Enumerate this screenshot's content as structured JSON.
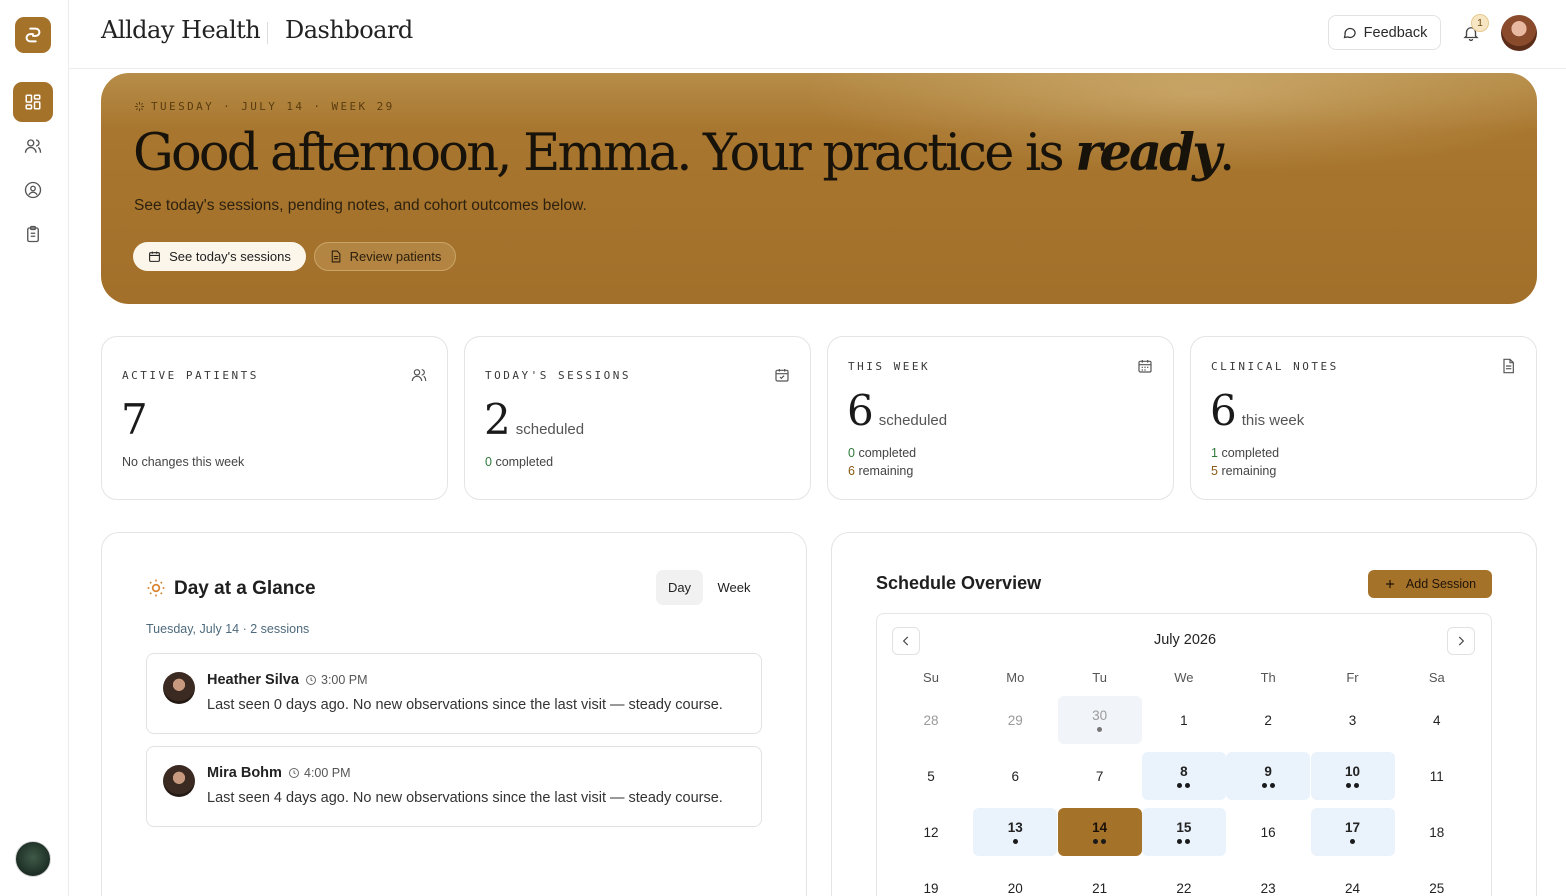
{
  "header": {
    "brand": "Allday Health",
    "page_title": "Dashboard",
    "feedback_label": "Feedback",
    "notification_count": "1"
  },
  "sidebar": {
    "items": [
      {
        "name": "dashboard",
        "icon": "grid-icon",
        "active": true
      },
      {
        "name": "patients",
        "icon": "users-icon",
        "active": false
      },
      {
        "name": "profile",
        "icon": "user-circle-icon",
        "active": false
      },
      {
        "name": "notes",
        "icon": "clipboard-icon",
        "active": false
      }
    ]
  },
  "hero": {
    "date_line": "TUESDAY · JULY 14 · WEEK 29",
    "greeting": "Good afternoon, Emma. Your practice is ",
    "greeting_emphasis": "ready",
    "greeting_end": ".",
    "subtitle": "See today's sessions, pending notes, and cohort outcomes below.",
    "btn_sessions": "See today's sessions",
    "btn_review": "Review patients"
  },
  "stats": {
    "active_patients": {
      "label": "ACTIVE PATIENTS",
      "value": "7",
      "note": "No changes this week"
    },
    "todays_sessions": {
      "label": "TODAY'S SESSIONS",
      "value": "2",
      "unit": "scheduled",
      "completed_num": "0",
      "completed_label": "completed"
    },
    "this_week": {
      "label": "THIS WEEK",
      "value": "6",
      "unit": "scheduled",
      "completed_num": "0",
      "completed_label": "completed",
      "remaining_num": "6",
      "remaining_label": "remaining"
    },
    "clinical_notes": {
      "label": "CLINICAL NOTES",
      "value": "6",
      "unit": "this week",
      "completed_num": "1",
      "completed_label": "completed",
      "remaining_num": "5",
      "remaining_label": "remaining"
    }
  },
  "day_glance": {
    "title": "Day at a Glance",
    "tab_day": "Day",
    "tab_week": "Week",
    "date_line": "Tuesday, July 14 · 2 sessions",
    "sessions": [
      {
        "name": "Heather Silva",
        "time": "3:00 PM",
        "text": "Last seen 0 days ago. No new observations since the last visit — steady course."
      },
      {
        "name": "Mira Bohm",
        "time": "4:00 PM",
        "text": "Last seen 4 days ago. No new observations since the last visit — steady course."
      }
    ]
  },
  "schedule": {
    "title": "Schedule Overview",
    "add_label": "Add Session",
    "month": "July 2026",
    "weekdays": [
      "Su",
      "Mo",
      "Tu",
      "We",
      "Th",
      "Fr",
      "Sa"
    ],
    "weeks": [
      [
        {
          "d": "28",
          "muted": true,
          "dots": 0
        },
        {
          "d": "29",
          "muted": true,
          "dots": 0
        },
        {
          "d": "30",
          "muted": true,
          "dots": 1,
          "prev": true
        },
        {
          "d": "1",
          "dots": 0
        },
        {
          "d": "2",
          "dots": 0
        },
        {
          "d": "3",
          "dots": 0
        },
        {
          "d": "4",
          "dots": 0
        }
      ],
      [
        {
          "d": "5",
          "dots": 0
        },
        {
          "d": "6",
          "dots": 0
        },
        {
          "d": "7",
          "dots": 0
        },
        {
          "d": "8",
          "dots": 2,
          "hl": true
        },
        {
          "d": "9",
          "dots": 2,
          "hl": true
        },
        {
          "d": "10",
          "dots": 2,
          "hl": true
        },
        {
          "d": "11",
          "dots": 0
        }
      ],
      [
        {
          "d": "12",
          "dots": 0
        },
        {
          "d": "13",
          "dots": 1,
          "hl": true
        },
        {
          "d": "14",
          "dots": 2,
          "sel": true
        },
        {
          "d": "15",
          "dots": 2,
          "hl": true
        },
        {
          "d": "16",
          "dots": 0
        },
        {
          "d": "17",
          "dots": 1,
          "hl": true
        },
        {
          "d": "18",
          "dots": 0
        }
      ],
      [
        {
          "d": "19",
          "dots": 0
        },
        {
          "d": "20",
          "dots": 0
        },
        {
          "d": "21",
          "dots": 0
        },
        {
          "d": "22",
          "dots": 0
        },
        {
          "d": "23",
          "dots": 0
        },
        {
          "d": "24",
          "dots": 0
        },
        {
          "d": "25",
          "dots": 0
        }
      ]
    ]
  },
  "colors": {
    "accent": "#a5722a",
    "highlight_day": "#eaf2fb",
    "completed_green": "#2f7a3a",
    "remaining_brown": "#8a5a12"
  }
}
